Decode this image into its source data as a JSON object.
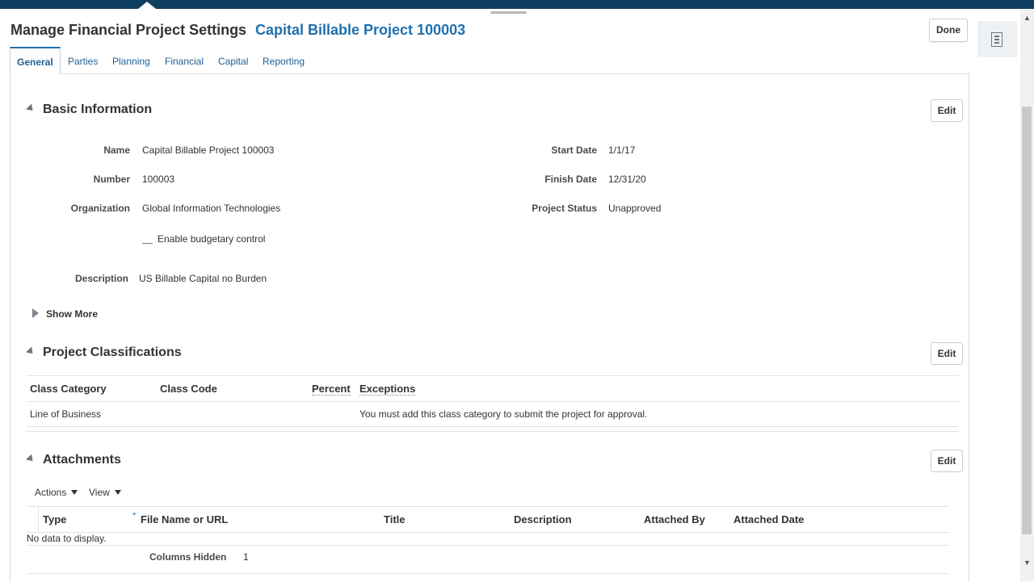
{
  "page": {
    "title": "Manage Financial Project Settings",
    "subtitle": "Capital Billable Project 100003",
    "done_label": "Done"
  },
  "tabs": [
    {
      "label": "General",
      "active": true
    },
    {
      "label": "Parties"
    },
    {
      "label": "Planning"
    },
    {
      "label": "Financial"
    },
    {
      "label": "Capital"
    },
    {
      "label": "Reporting"
    }
  ],
  "basic_info": {
    "title": "Basic Information",
    "edit_label": "Edit",
    "fields": {
      "name_label": "Name",
      "name_value": "Capital Billable Project 100003",
      "number_label": "Number",
      "number_value": "100003",
      "organization_label": "Organization",
      "organization_value": "Global Information Technologies",
      "budgetary_label": "Enable budgetary control",
      "description_label": "Description",
      "description_value": "US Billable Capital no Burden",
      "start_date_label": "Start Date",
      "start_date_value": "1/1/17",
      "finish_date_label": "Finish Date",
      "finish_date_value": "12/31/20",
      "status_label": "Project Status",
      "status_value": "Unapproved"
    },
    "show_more_label": "Show More"
  },
  "classifications": {
    "title": "Project Classifications",
    "edit_label": "Edit",
    "columns": [
      "Class Category",
      "Class Code",
      "Percent",
      "Exceptions"
    ],
    "rows": [
      {
        "class_category": "Line of Business",
        "class_code": "",
        "percent": "",
        "exceptions": "You must add this class category to submit the project for approval."
      }
    ]
  },
  "attachments": {
    "title": "Attachments",
    "edit_label": "Edit",
    "toolbar": {
      "actions_label": "Actions",
      "view_label": "View"
    },
    "required_marker": "*",
    "columns": [
      "Type",
      "File Name or URL",
      "Title",
      "Description",
      "Attached By",
      "Attached Date"
    ],
    "empty_text": "No data to display.",
    "columns_hidden_label": "Columns Hidden",
    "columns_hidden_value": "1"
  },
  "colors": {
    "header_bar": "#0e3e60",
    "link_blue": "#1f6fad",
    "border": "#d6dde3"
  },
  "icons": {
    "side_dock": "document-icon",
    "collapse": "triangle-down-icon",
    "expand": "triangle-right-icon",
    "dropdown": "caret-down-icon"
  }
}
